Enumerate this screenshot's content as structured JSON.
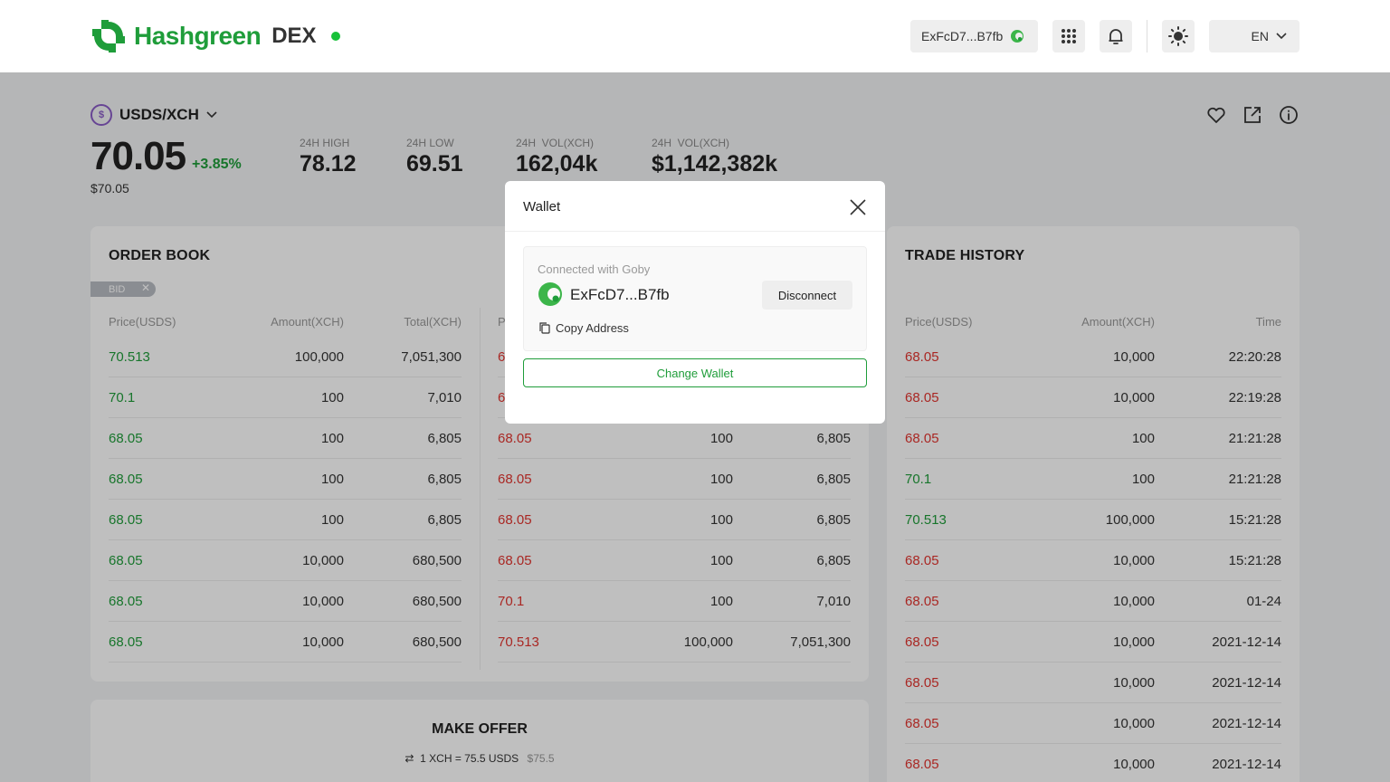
{
  "header": {
    "brand": "Hashgreen",
    "product": "DEX",
    "wallet_address": "ExFcD7...B7fb",
    "language": "EN",
    "accent": "#1f9d3a"
  },
  "market": {
    "pair": "USDS/XCH",
    "price": "70.05",
    "change": "+3.85%",
    "price_usd": "$70.05",
    "stats": [
      {
        "label": "24H HIGH",
        "value": "78.12"
      },
      {
        "label": "24H LOW",
        "value": "69.51"
      },
      {
        "label": "24H  VOL(XCH)",
        "value": "162,04k"
      },
      {
        "label": "24H  VOL(XCH)",
        "value": "$1,142,382k"
      }
    ]
  },
  "order_book": {
    "title": "ORDER BOOK",
    "filter_tag": "BID",
    "columns": [
      "Price(USDS)",
      "Amount(XCH)",
      "Total(XCH)"
    ],
    "right_col_head_partial": "P",
    "bids": [
      [
        "70.513",
        "100,000",
        "7,051,300"
      ],
      [
        "70.1",
        "100",
        "7,010"
      ],
      [
        "68.05",
        "100",
        "6,805"
      ],
      [
        "68.05",
        "100",
        "6,805"
      ],
      [
        "68.05",
        "100",
        "6,805"
      ],
      [
        "68.05",
        "10,000",
        "680,500"
      ],
      [
        "68.05",
        "10,000",
        "680,500"
      ],
      [
        "68.05",
        "10,000",
        "680,500"
      ]
    ],
    "asks": [
      [
        "6",
        "",
        ""
      ],
      [
        "6",
        "",
        ""
      ],
      [
        "68.05",
        "100",
        "6,805"
      ],
      [
        "68.05",
        "100",
        "6,805"
      ],
      [
        "68.05",
        "100",
        "6,805"
      ],
      [
        "68.05",
        "100",
        "6,805"
      ],
      [
        "70.1",
        "100",
        "7,010"
      ],
      [
        "70.513",
        "100,000",
        "7,051,300"
      ]
    ]
  },
  "trade_history": {
    "title": "TRADE HISTORY",
    "columns": [
      "Price(USDS)",
      "Amount(XCH)",
      "Time"
    ],
    "rows": [
      {
        "price": "68.05",
        "amount": "10,000",
        "time": "22:20:28",
        "side": "sell"
      },
      {
        "price": "68.05",
        "amount": "10,000",
        "time": "22:19:28",
        "side": "sell"
      },
      {
        "price": "68.05",
        "amount": "100",
        "time": "21:21:28",
        "side": "sell"
      },
      {
        "price": "70.1",
        "amount": "100",
        "time": "21:21:28",
        "side": "buy"
      },
      {
        "price": "70.513",
        "amount": "100,000",
        "time": "15:21:28",
        "side": "buy"
      },
      {
        "price": "68.05",
        "amount": "10,000",
        "time": "15:21:28",
        "side": "sell"
      },
      {
        "price": "68.05",
        "amount": "10,000",
        "time": "01-24",
        "side": "sell"
      },
      {
        "price": "68.05",
        "amount": "10,000",
        "time": "2021-12-14",
        "side": "sell"
      },
      {
        "price": "68.05",
        "amount": "10,000",
        "time": "2021-12-14",
        "side": "sell"
      },
      {
        "price": "68.05",
        "amount": "10,000",
        "time": "2021-12-14",
        "side": "sell"
      },
      {
        "price": "68.05",
        "amount": "10,000",
        "time": "2021-12-14",
        "side": "sell"
      }
    ]
  },
  "make_offer": {
    "title": "MAKE OFFER",
    "rate": "1 XCH = 75.5 USDS",
    "rate_usd": "$75.5"
  },
  "wallet_modal": {
    "title": "Wallet",
    "connected_label": "Connected with Goby",
    "address": "ExFcD7...B7fb",
    "disconnect_label": "Disconnect",
    "copy_label": "Copy Address",
    "change_label": "Change Wallet"
  },
  "icons": [
    "hashgreen-logo-icon",
    "goby-icon",
    "apps-grid-icon",
    "bell-icon",
    "sun-icon",
    "chevron-down-icon",
    "coin-icon",
    "heart-icon",
    "external-link-icon",
    "info-icon",
    "close-icon",
    "copy-icon",
    "swap-icon"
  ]
}
